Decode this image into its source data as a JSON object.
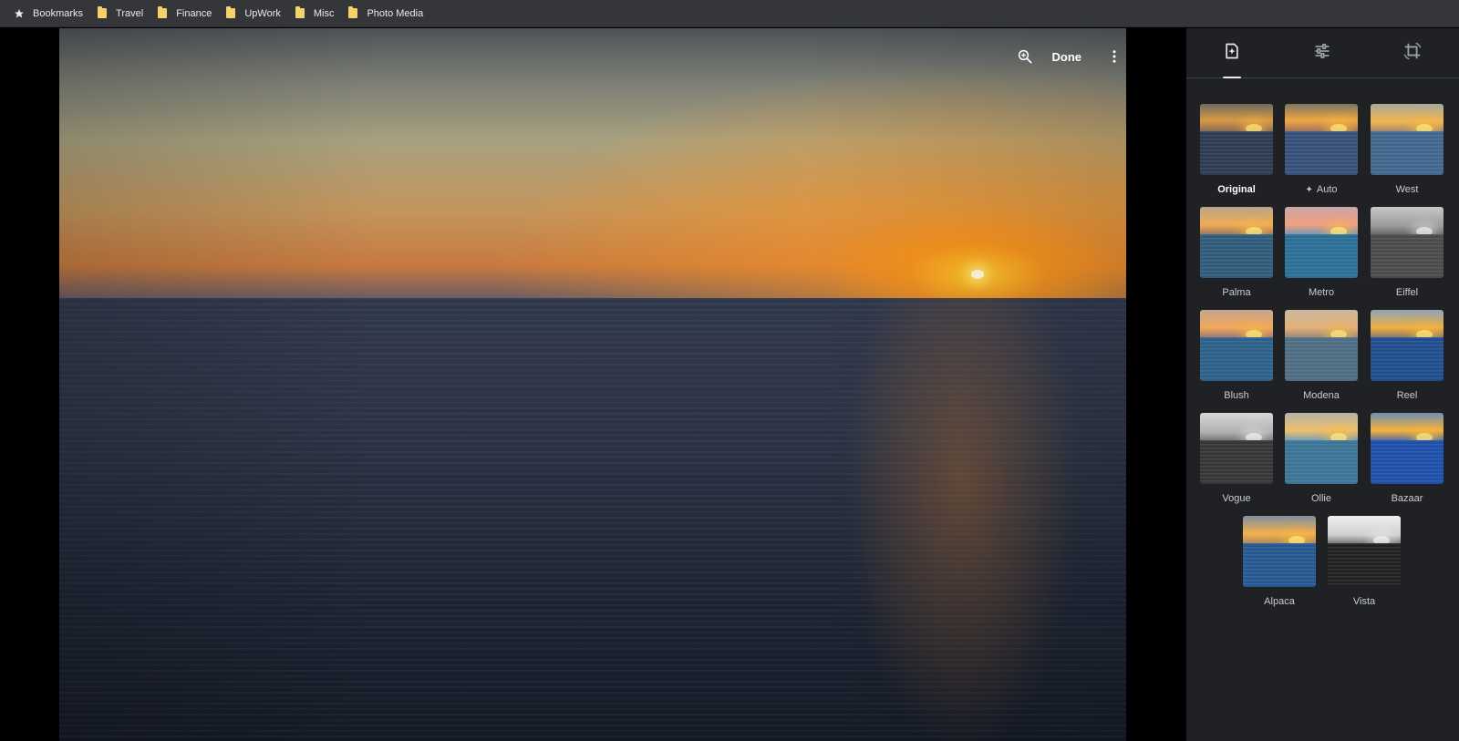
{
  "bookmarks_bar": {
    "items": [
      {
        "label": "Bookmarks",
        "icon": "star-icon"
      },
      {
        "label": "Travel",
        "icon": "folder-icon"
      },
      {
        "label": "Finance",
        "icon": "folder-icon"
      },
      {
        "label": "UpWork",
        "icon": "folder-icon"
      },
      {
        "label": "Misc",
        "icon": "folder-icon"
      },
      {
        "label": "Photo Media",
        "icon": "folder-icon"
      }
    ]
  },
  "viewer": {
    "done_label": "Done",
    "zoom_icon": "zoom-in-icon",
    "more_icon": "more-vert-icon"
  },
  "editor_panel": {
    "tabs": [
      {
        "name": "filters",
        "icon": "photo-filter-icon",
        "active": true
      },
      {
        "name": "adjust",
        "icon": "tune-icon",
        "active": false
      },
      {
        "name": "crop-rotate",
        "icon": "crop-rotate-icon",
        "active": false
      }
    ],
    "filters": [
      {
        "label": "Original",
        "selected": true
      },
      {
        "label": "Auto",
        "selected": false,
        "icon": "sparkle-icon"
      },
      {
        "label": "West",
        "selected": false
      },
      {
        "label": "Palma",
        "selected": false
      },
      {
        "label": "Metro",
        "selected": false
      },
      {
        "label": "Eiffel",
        "selected": false
      },
      {
        "label": "Blush",
        "selected": false
      },
      {
        "label": "Modena",
        "selected": false
      },
      {
        "label": "Reel",
        "selected": false
      },
      {
        "label": "Vogue",
        "selected": false
      },
      {
        "label": "Ollie",
        "selected": false
      },
      {
        "label": "Bazaar",
        "selected": false
      },
      {
        "label": "Alpaca",
        "selected": false
      },
      {
        "label": "Vista",
        "selected": false
      }
    ]
  },
  "colors": {
    "bookmarks_bar_bg": "#35363a",
    "panel_bg": "#202124",
    "viewer_bg": "#000000",
    "folder_icon": "#f5d36a"
  }
}
